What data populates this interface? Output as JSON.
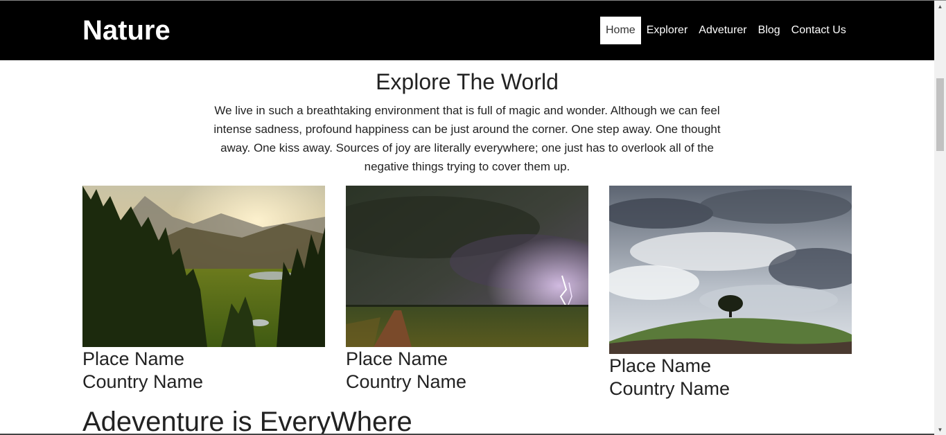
{
  "navbar": {
    "brand": "Nature",
    "items": [
      {
        "label": "Home",
        "active": true
      },
      {
        "label": "Explorer",
        "active": false
      },
      {
        "label": "Adveturer",
        "active": false
      },
      {
        "label": "Blog",
        "active": false
      },
      {
        "label": "Contact Us",
        "active": false
      }
    ]
  },
  "hero": {
    "title": "Explore The World",
    "text": "We live in such a breathtaking environment that is full of magic and wonder. Although we can feel intense sadness, profound happiness can be just around the corner. One step away. One thought away. One kiss away. Sources of joy are literally everywhere; one just has to overlook all of the negative things trying to cover them up."
  },
  "cards": [
    {
      "place": "Place Name",
      "country": "Country Name",
      "image": "mountain-valley-sunset-photo"
    },
    {
      "place": "Place Name",
      "country": "Country Name",
      "image": "lightning-storm-field-photo"
    },
    {
      "place": "Place Name",
      "country": "Country Name",
      "image": "cloudy-sky-hill-tree-photo"
    }
  ],
  "section": {
    "title": "Adeventure is EveryWhere"
  },
  "colors": {
    "navbar_bg": "#000000",
    "nav_active_bg": "#ffffff"
  }
}
